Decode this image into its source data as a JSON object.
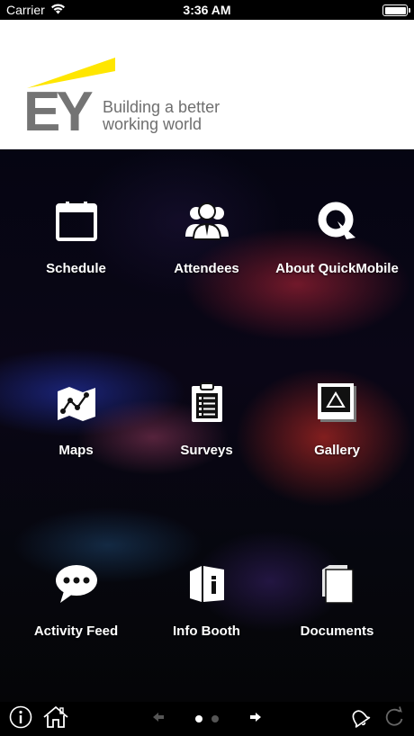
{
  "status_bar": {
    "carrier": "Carrier",
    "time": "3:36 AM",
    "wifi_icon": "wifi-icon",
    "battery_icon": "battery-icon",
    "battery_level": 1.0
  },
  "banner": {
    "logo_text": "EY",
    "tagline_line1": "Building a better",
    "tagline_line2": "working world",
    "colors": {
      "logo_yellow": "#FFE600",
      "logo_grey": "#747474",
      "tagline": "#6f6f6f"
    }
  },
  "menu": {
    "items": [
      {
        "label": "Schedule",
        "icon": "calendar-icon"
      },
      {
        "label": "Attendees",
        "icon": "people-icon"
      },
      {
        "label": "About QuickMobile",
        "icon": "quickmobile-logo-icon"
      },
      {
        "label": "Maps",
        "icon": "map-icon"
      },
      {
        "label": "Surveys",
        "icon": "clipboard-icon"
      },
      {
        "label": "Gallery",
        "icon": "picture-icon"
      },
      {
        "label": "Activity Feed",
        "icon": "speech-bubble-icon"
      },
      {
        "label": "Info Booth",
        "icon": "info-booth-icon"
      },
      {
        "label": "Documents",
        "icon": "documents-icon"
      }
    ]
  },
  "bottom_bar": {
    "info_icon": "info-icon",
    "home_icon": "home-icon",
    "prev_icon": "arrow-left-icon",
    "next_icon": "arrow-right-icon",
    "notification_icon": "bell-icon",
    "refresh_icon": "refresh-icon",
    "page_count": 2,
    "current_page": 1
  }
}
